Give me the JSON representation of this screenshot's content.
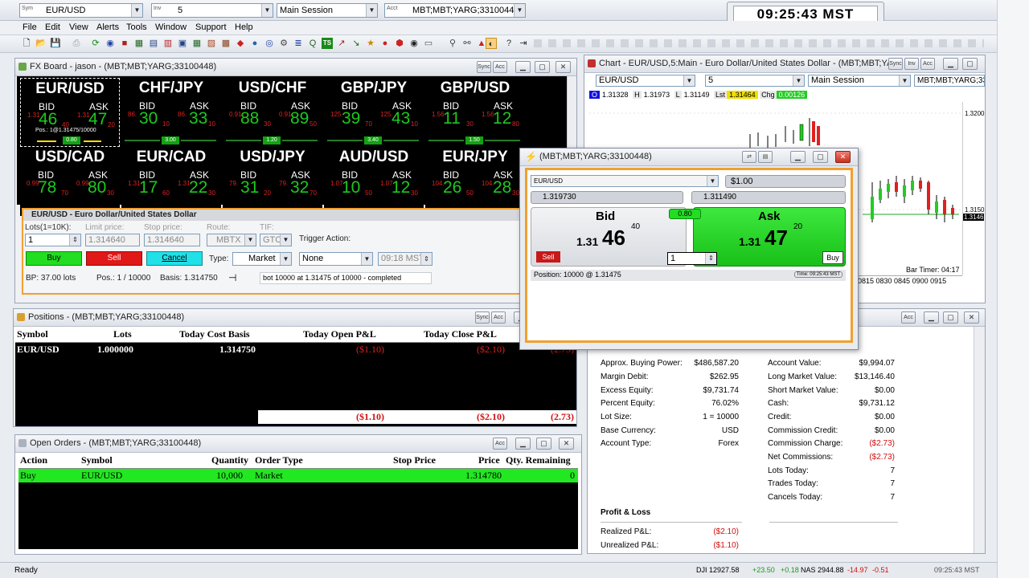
{
  "topbar": {
    "symbol_label": "Sym",
    "symbol": "EUR/USD",
    "interval_label": "Inv",
    "interval": "5",
    "session": "Main Session",
    "account_label": "Acct",
    "account": "MBT;MBT;YARG;33100448",
    "clock": "09:25:43 MST"
  },
  "menu": [
    "File",
    "Edit",
    "View",
    "Alerts",
    "Tools",
    "Window",
    "Support",
    "Help"
  ],
  "fxboard": {
    "title": "FX Board - jason - (MBT;MBT;YARG;33100448)",
    "sync_label": "Sync",
    "acct_label": "Acc",
    "tiles": [
      {
        "pair": "EUR/USD",
        "bid_label": "BID",
        "ask_label": "ASK",
        "bid_big": "1.31",
        "bid": "46",
        "bid_small": "40",
        "ask_big": "1.31",
        "ask": "47",
        "ask_small": "20",
        "spread": "0.80",
        "pos": "Pos.: 1@1.31475/10000"
      },
      {
        "pair": "CHF/JPY",
        "bid_label": "BID",
        "ask_label": "ASK",
        "bid_big": "86.",
        "bid": "30",
        "bid_small": "10",
        "ask_big": "86.",
        "ask": "33",
        "ask_small": "10",
        "spread": "3.00",
        "pos": ""
      },
      {
        "pair": "USD/CHF",
        "bid_label": "BID",
        "ask_label": "ASK",
        "bid_big": "0.91",
        "bid": "88",
        "bid_small": "30",
        "ask_big": "0.91",
        "ask": "89",
        "ask_small": "50",
        "spread": "1.20",
        "pos": ""
      },
      {
        "pair": "GBP/JPY",
        "bid_label": "BID",
        "ask_label": "ASK",
        "bid_big": "125.",
        "bid": "39",
        "bid_small": "70",
        "ask_big": "125.",
        "ask": "43",
        "ask_small": "10",
        "spread": "3.40",
        "pos": ""
      },
      {
        "pair": "GBP/USD",
        "bid_label": "BID",
        "ask_label": "ASK",
        "bid_big": "1.56",
        "bid": "11",
        "bid_small": "30",
        "ask_big": "1.56",
        "ask": "12",
        "ask_small": "80",
        "spread": "1.50",
        "pos": ""
      },
      {
        "pair": "USD/CAD",
        "bid_label": "BID",
        "ask_label": "ASK",
        "bid_big": "0.99",
        "bid": "78",
        "bid_small": "70",
        "ask_big": "0.99",
        "ask": "80",
        "ask_small": "30",
        "spread": "",
        "pos": ""
      },
      {
        "pair": "EUR/CAD",
        "bid_label": "BID",
        "ask_label": "ASK",
        "bid_big": "1.31",
        "bid": "17",
        "bid_small": "60",
        "ask_big": "1.31",
        "ask": "22",
        "ask_small": "30",
        "spread": "",
        "pos": ""
      },
      {
        "pair": "USD/JPY",
        "bid_label": "BID",
        "ask_label": "ASK",
        "bid_big": "79.",
        "bid": "31",
        "bid_small": "20",
        "ask_big": "79.",
        "ask": "32",
        "ask_small": "70",
        "spread": "",
        "pos": ""
      },
      {
        "pair": "AUD/USD",
        "bid_label": "BID",
        "ask_label": "ASK",
        "bid_big": "1.07",
        "bid": "10",
        "bid_small": "50",
        "ask_big": "1.07",
        "ask": "12",
        "ask_small": "30",
        "spread": "",
        "pos": ""
      },
      {
        "pair": "EUR/JPY",
        "bid_label": "BID",
        "ask_label": "ASK",
        "bid_big": "104.",
        "bid": "26",
        "bid_small": "50",
        "ask_big": "104.",
        "ask": "28",
        "ask_small": "30",
        "spread": "",
        "pos": ""
      }
    ],
    "order": {
      "title": "EUR/USD - Euro Dollar/United States Dollar",
      "lots_label": "Lots(1=10K):",
      "lots": "1",
      "limit_label": "Limit price:",
      "limit": "1.314640",
      "stop_label": "Stop price:",
      "stop": "1.314640",
      "route_label": "Route:",
      "route": "MBTX",
      "tif_label": "TIF:",
      "tif": "GTC",
      "trigger_label": "Trigger Action:",
      "trigger": "None",
      "time": "09:18 MST",
      "buy": "Buy",
      "sell": "Sell",
      "cancel": "Cancel",
      "type_label": "Type:",
      "type": "Market",
      "bp": "BP: 37.00 lots",
      "pos": "Pos.: 1 / 10000",
      "basis": "Basis:  1.314750",
      "status": "bot 10000 at 1.31475 of 10000 - completed"
    }
  },
  "chart": {
    "title": "Chart - EUR/USD,5:Main - Euro Dollar/United States Dollar - (MBT;MBT;YAR",
    "sync_label": "Sync",
    "inv_label": "Inv",
    "acct_label": "Acc",
    "symbol": "EUR/USD",
    "interval": "5",
    "session": "Main Session",
    "account": "MBT;MBT;YARG;33100448",
    "o_label": "O",
    "o": "1.31328",
    "h_label": "H",
    "h": "1.31973",
    "l_label": "L",
    "l": "1.31149",
    "lst_label": "Lst",
    "lst": "1.31464",
    "chg_label": "Chg",
    "chg": "0.00126",
    "y1": "1.3200",
    "y2": "1.3150",
    "last_tag": "1.3146",
    "bar_timer": "Bar Timer: 04:17",
    "x_labels": "0815 0830 0845 0900 0915"
  },
  "ticket": {
    "title": "(MBT;MBT;YARG;33100448)",
    "symbol": "EUR/USD",
    "amount": "$1.00",
    "low_sell": "1.319730",
    "low_buy": "1.311490",
    "bid_label": "Bid",
    "ask_label": "Ask",
    "bid_prefix": "1.31",
    "bid_big": "46",
    "bid_sup": "40",
    "ask_prefix": "1.31",
    "ask_big": "47",
    "ask_sup": "20",
    "spread": "0.80",
    "sell": "Sell",
    "buy": "Buy",
    "qty": "1",
    "position": "Position: 10000 @ 1.31475",
    "time": "Time: 09:25:43 MST"
  },
  "positions": {
    "title": "Positions - (MBT;MBT;YARG;33100448)",
    "sync_label": "Sync",
    "acct_label": "Acc",
    "headers": [
      "Symbol",
      "Lots",
      "Today Cost Basis",
      "Today Open P&L",
      "Today Close P&L"
    ],
    "row": {
      "symbol": "EUR/USD",
      "lots": "1.000000",
      "basis": "1.314750",
      "open": "($1.10)",
      "close": "($2.10)",
      "extra": "(2.73)"
    },
    "totals": {
      "open": "($1.10)",
      "close": "($2.10)",
      "extra": "(2.73)"
    }
  },
  "orders": {
    "title": "Open Orders - (MBT;MBT;YARG;33100448)",
    "acct_label": "Acc",
    "headers": [
      "Action",
      "Symbol",
      "Quantity",
      "Order Type",
      "Stop Price",
      "Price",
      "Qty. Remaining"
    ],
    "row": {
      "action": "Buy",
      "symbol": "EUR/USD",
      "qty": "10,000",
      "type": "Market",
      "stop": "",
      "price": "1.314780",
      "remaining": "0"
    }
  },
  "account": {
    "acct_label": "Acc",
    "left": [
      {
        "k": "Approx. Buying Power:",
        "v": "$486,587.20"
      },
      {
        "k": "Margin Debit:",
        "v": "$262.95"
      },
      {
        "k": "Excess Equity:",
        "v": "$9,731.74"
      },
      {
        "k": "Percent Equity:",
        "v": "76.02%"
      },
      {
        "k": "Lot Size:",
        "v": "1 = 10000"
      },
      {
        "k": "Base Currency:",
        "v": "USD"
      },
      {
        "k": "Account Type:",
        "v": "Forex"
      }
    ],
    "right": [
      {
        "k": "Account Value:",
        "v": "$9,994.07"
      },
      {
        "k": "Long Market Value:",
        "v": "$13,146.40"
      },
      {
        "k": "Short Market Value:",
        "v": "$0.00"
      },
      {
        "k": "Cash:",
        "v": "$9,731.12"
      },
      {
        "k": "Credit:",
        "v": "$0.00"
      },
      {
        "k": "Commission Credit:",
        "v": "$0.00"
      },
      {
        "k": "Commission Charge:",
        "v": "($2.73)"
      },
      {
        "k": "Net Commissions:",
        "v": "($2.73)"
      },
      {
        "k": "Lots Today:",
        "v": "7"
      },
      {
        "k": "Trades Today:",
        "v": "7"
      },
      {
        "k": "Cancels Today:",
        "v": "7"
      }
    ],
    "pl_title": "Profit & Loss",
    "realized_label": "Realized P&L:",
    "realized": "($2.10)",
    "unrealized_label": "Unrealized P&L:",
    "unrealized": "($1.10)"
  },
  "status": {
    "ready": "Ready",
    "dji": "DJI 12927.58",
    "dji_chg": "+23.50",
    "dji_pct": "+0.18",
    "nas": "NAS 2944.88",
    "nas_chg": "-14.97",
    "nas_pct": "-0.51",
    "time": "09:25:43 MST"
  },
  "colors": {
    "bid_green": "#1ec81e",
    "loss_red": "#d01010",
    "buy_green": "#22dd22",
    "sell_red": "#e01818",
    "cancel_cyan": "#20e0e8",
    "orange_border": "#f0a030"
  }
}
